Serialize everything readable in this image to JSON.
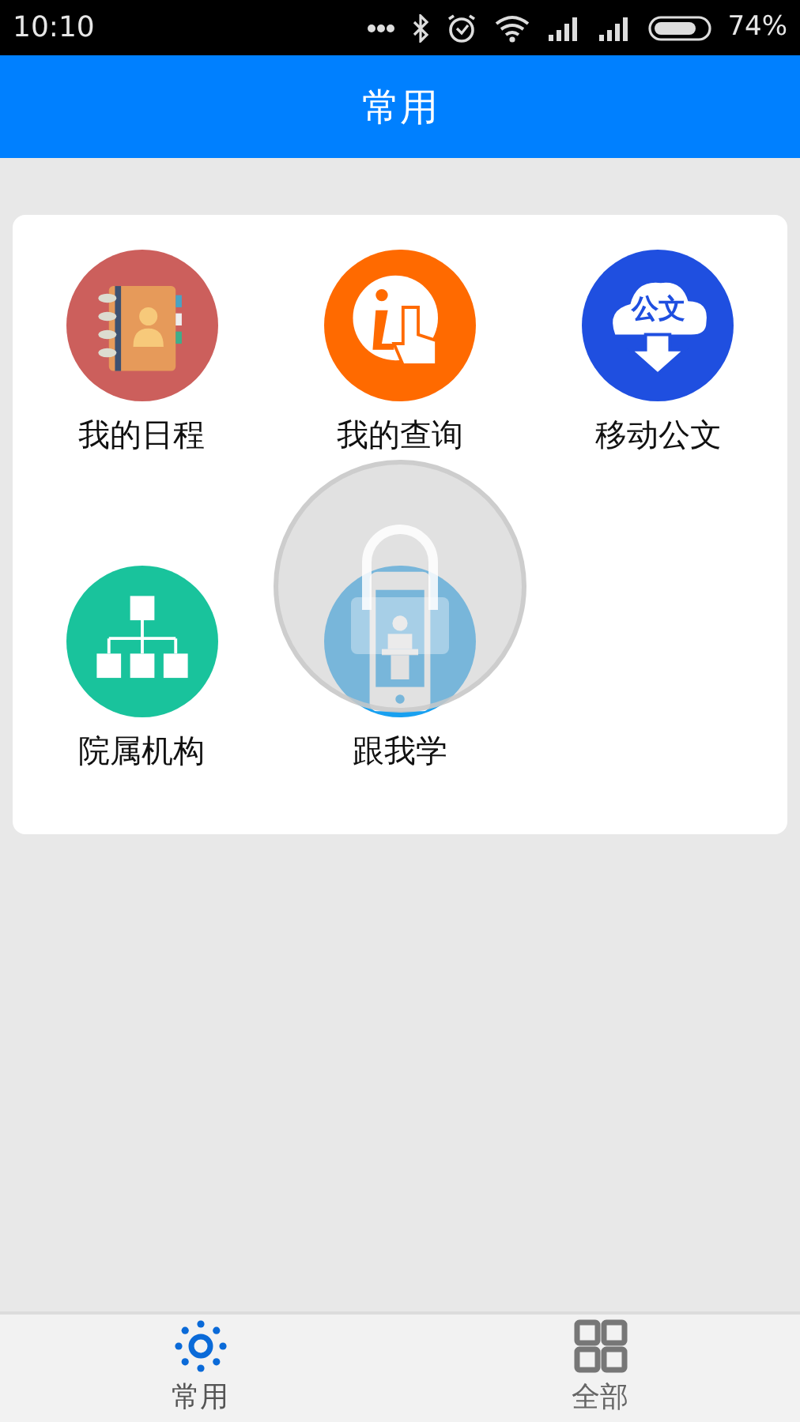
{
  "status_bar": {
    "time": "10:10",
    "battery": "74%"
  },
  "header": {
    "title": "常用"
  },
  "apps": [
    {
      "kind": "contacts",
      "label": "我的日程"
    },
    {
      "kind": "query",
      "label": "我的查询"
    },
    {
      "kind": "document",
      "label": "移动公文",
      "icon_text": "公文"
    },
    {
      "kind": "org",
      "label": "院属机构"
    },
    {
      "kind": "lecture",
      "label": "跟我学"
    }
  ],
  "tabs": [
    {
      "label": "常用",
      "selected": true,
      "kind": "sun"
    },
    {
      "label": "全部",
      "selected": false,
      "kind": "grid"
    }
  ]
}
